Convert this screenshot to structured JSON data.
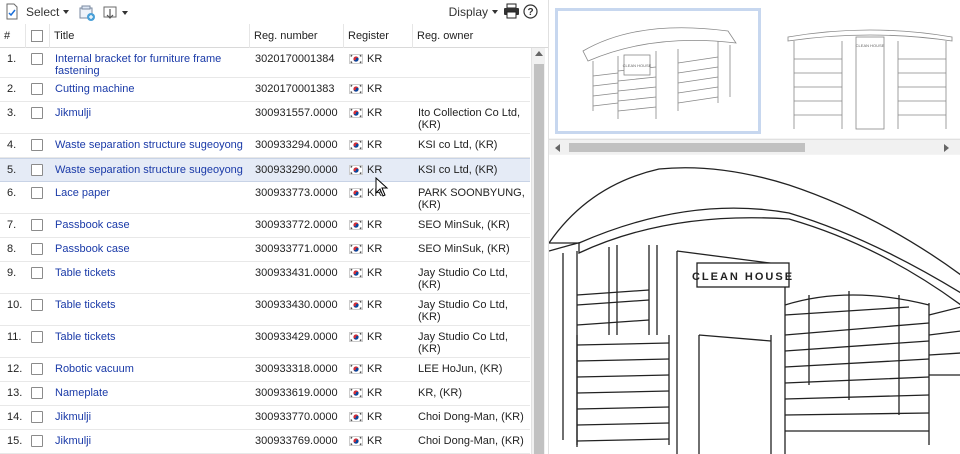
{
  "toolbar": {
    "select_label": "Select",
    "display_label": "Display"
  },
  "table": {
    "headers": {
      "num": "#",
      "title": "Title",
      "reg_number": "Reg. number",
      "register": "Register",
      "owner": "Reg. owner"
    },
    "rows": [
      {
        "num": "1.",
        "title": "Internal bracket for furniture frame fastening",
        "reg": "3020170001384",
        "country": "KR",
        "owner": ""
      },
      {
        "num": "2.",
        "title": "Cutting machine",
        "reg": "3020170001383",
        "country": "KR",
        "owner": ""
      },
      {
        "num": "3.",
        "title": "Jikmulji",
        "reg": "300931557.0000",
        "country": "KR",
        "owner": "Ito Collection Co Ltd, (KR)"
      },
      {
        "num": "4.",
        "title": "Waste separation structure sugeoyong",
        "reg": "300933294.0000",
        "country": "KR",
        "owner": "KSI co Ltd, (KR)"
      },
      {
        "num": "5.",
        "title": "Waste separation structure sugeoyong",
        "reg": "300933290.0000",
        "country": "KR",
        "owner": "KSI co Ltd, (KR)"
      },
      {
        "num": "6.",
        "title": "Lace paper",
        "reg": "300933773.0000",
        "country": "KR",
        "owner": "PARK SOONBYUNG, (KR)"
      },
      {
        "num": "7.",
        "title": "Passbook case",
        "reg": "300933772.0000",
        "country": "KR",
        "owner": "SEO MinSuk, (KR)"
      },
      {
        "num": "8.",
        "title": "Passbook case",
        "reg": "300933771.0000",
        "country": "KR",
        "owner": "SEO MinSuk, (KR)"
      },
      {
        "num": "9.",
        "title": "Table tickets",
        "reg": "300933431.0000",
        "country": "KR",
        "owner": "Jay Studio Co Ltd, (KR)"
      },
      {
        "num": "10.",
        "title": "Table tickets",
        "reg": "300933430.0000",
        "country": "KR",
        "owner": "Jay Studio Co Ltd, (KR)"
      },
      {
        "num": "11.",
        "title": "Table tickets",
        "reg": "300933429.0000",
        "country": "KR",
        "owner": "Jay Studio Co Ltd, (KR)"
      },
      {
        "num": "12.",
        "title": "Robotic vacuum",
        "reg": "300933318.0000",
        "country": "KR",
        "owner": "LEE HoJun, (KR)"
      },
      {
        "num": "13.",
        "title": "Nameplate",
        "reg": "300933619.0000",
        "country": "KR",
        "owner": "KR, (KR)"
      },
      {
        "num": "14.",
        "title": "Jikmulji",
        "reg": "300933770.0000",
        "country": "KR",
        "owner": "Choi Dong-Man, (KR)"
      },
      {
        "num": "15.",
        "title": "Jikmulji",
        "reg": "300933769.0000",
        "country": "KR",
        "owner": "Choi Dong-Man, (KR)"
      }
    ]
  },
  "preview": {
    "sign_text": "CLEAN HOUSE"
  },
  "colors": {
    "link": "#1a3aa8",
    "selected_row": "#e5ebf6",
    "thumb_selected_border": "#c7d7ef"
  }
}
